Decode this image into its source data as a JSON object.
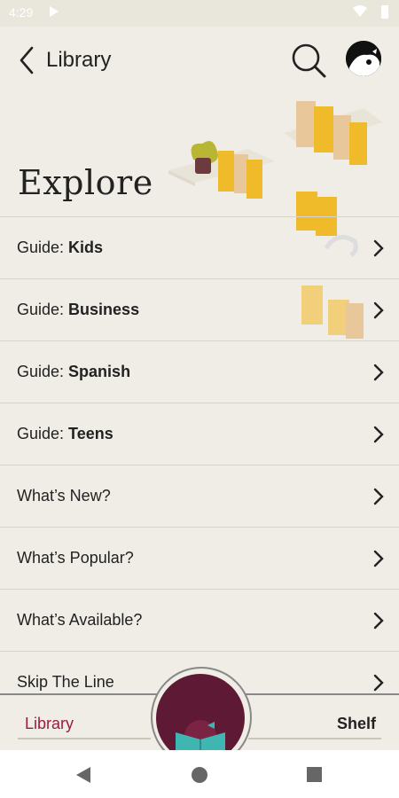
{
  "status_bar": {
    "time": "4:29"
  },
  "nav": {
    "back_label": "Library"
  },
  "hero": {
    "title": "Explore"
  },
  "list": [
    {
      "prefix": "Guide: ",
      "bold": "Kids"
    },
    {
      "prefix": "Guide: ",
      "bold": "Business"
    },
    {
      "prefix": "Guide: ",
      "bold": "Spanish"
    },
    {
      "prefix": "Guide: ",
      "bold": "Teens"
    },
    {
      "prefix": "What’s New?",
      "bold": ""
    },
    {
      "prefix": "What’s Popular?",
      "bold": ""
    },
    {
      "prefix": "What’s Available?",
      "bold": ""
    },
    {
      "prefix": "Skip The Line",
      "bold": ""
    }
  ],
  "tabs": {
    "library": "Library",
    "shelf": "Shelf"
  },
  "colors": {
    "accent": "#9b1c3e",
    "fab": "#5e1a34",
    "book": "#f0c030",
    "background": "#efede5"
  },
  "icons": {
    "back": "chevron-left-icon",
    "search": "magnifier-icon",
    "avatar": "owl-avatar-icon",
    "row": "chevron-right-icon",
    "fab": "reading-icon"
  }
}
